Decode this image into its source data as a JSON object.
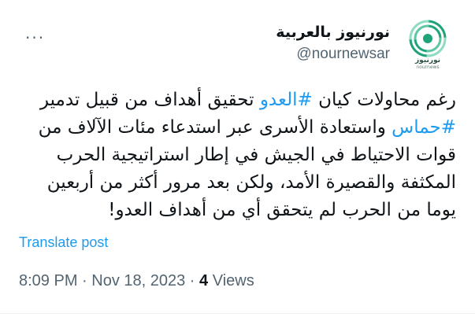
{
  "author": {
    "display_name": "نورنيوز بالعربية",
    "handle": "@nournewsar",
    "avatar_brand": "نورنيوز",
    "avatar_sub": "nournews"
  },
  "tweet": {
    "segment1": "رغم محاولات كيان ",
    "hashtag1": "#العدو",
    "segment2": " تحقيق أهداف من قبيل تدمير ",
    "hashtag2": "#حماس",
    "segment3": " واستعادة الأسرى عبر استدعاء مئات الآلاف من قوات الاحتياط في الجيش في إطار استراتيجية الحرب المكثفة والقصيرة الأمد، ولكن بعد مرور أكثر من أربعين يوما من الحرب لم يتحقق أي من أهداف العدو!"
  },
  "translate_label": "Translate post",
  "meta": {
    "time": "8:09 PM",
    "sep1": " · ",
    "date": "Nov 18, 2023",
    "sep2": " · ",
    "views_count": "4",
    "views_label": " Views"
  },
  "more_label": "···",
  "colors": {
    "link": "#1d9bf0",
    "muted": "#536471",
    "text": "#0f1419",
    "logo": "#1fa37a"
  }
}
